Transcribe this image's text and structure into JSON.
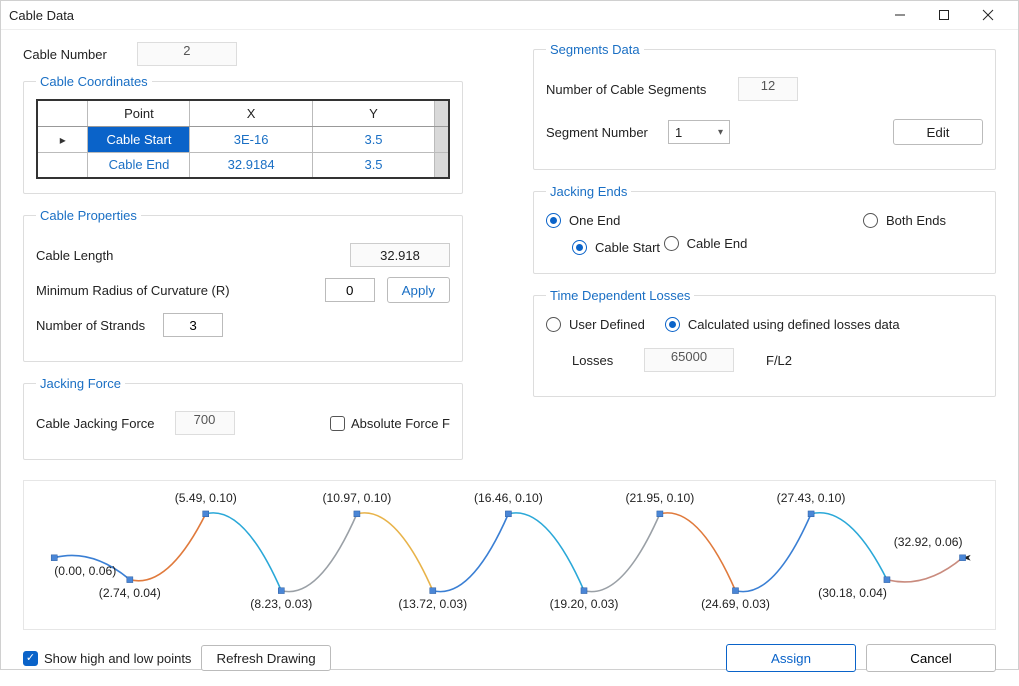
{
  "window": {
    "title": "Cable Data"
  },
  "cable_number": {
    "label": "Cable Number",
    "value": "2"
  },
  "coords": {
    "legend": "Cable Coordinates",
    "headers": {
      "point": "Point",
      "x": "X",
      "y": "Y"
    },
    "rows": [
      {
        "point": "Cable Start",
        "x": "3E-16",
        "y": "3.5",
        "selected": true
      },
      {
        "point": "Cable End",
        "x": "32.9184",
        "y": "3.5",
        "selected": false
      }
    ]
  },
  "properties": {
    "legend": "Cable Properties",
    "length_label": "Cable Length",
    "length_value": "32.918",
    "radius_label": "Minimum Radius of Curvature (R)",
    "radius_value": "0",
    "apply_label": "Apply",
    "strands_label": "Number of Strands",
    "strands_value": "3"
  },
  "jacking_force": {
    "legend": "Jacking Force",
    "label": "Cable Jacking Force",
    "value": "700",
    "absolute_label": "Absolute Force  F",
    "absolute_checked": false
  },
  "segments": {
    "legend": "Segments Data",
    "count_label": "Number of Cable Segments",
    "count_value": "12",
    "number_label": "Segment Number",
    "number_value": "1",
    "edit_label": "Edit"
  },
  "jacking_ends": {
    "legend": "Jacking Ends",
    "one_end": "One End",
    "both_ends": "Both Ends",
    "cable_start": "Cable Start",
    "cable_end": "Cable End",
    "selected_primary": "one_end",
    "selected_sub": "cable_start"
  },
  "losses": {
    "legend": "Time Dependent Losses",
    "user_defined": "User Defined",
    "calculated": "Calculated using defined losses data",
    "selected": "calculated",
    "losses_label": "Losses",
    "losses_value": "65000",
    "unit": "F/L2"
  },
  "graph": {
    "points": [
      {
        "x": 0.0,
        "y": 0.06,
        "pos": "below"
      },
      {
        "x": 2.74,
        "y": 0.04,
        "pos": "below"
      },
      {
        "x": 5.49,
        "y": 0.1,
        "pos": "above"
      },
      {
        "x": 8.23,
        "y": 0.03,
        "pos": "below"
      },
      {
        "x": 10.97,
        "y": 0.1,
        "pos": "above"
      },
      {
        "x": 13.72,
        "y": 0.03,
        "pos": "below"
      },
      {
        "x": 16.46,
        "y": 0.1,
        "pos": "above"
      },
      {
        "x": 19.2,
        "y": 0.03,
        "pos": "below"
      },
      {
        "x": 21.95,
        "y": 0.1,
        "pos": "above"
      },
      {
        "x": 24.69,
        "y": 0.03,
        "pos": "below"
      },
      {
        "x": 27.43,
        "y": 0.1,
        "pos": "above"
      },
      {
        "x": 30.18,
        "y": 0.04,
        "pos": "below"
      },
      {
        "x": 32.92,
        "y": 0.06,
        "pos": "above"
      }
    ],
    "segment_colors": [
      "#3a7fd4",
      "#e07a3c",
      "#2aa8d8",
      "#9aa0a6",
      "#e8b34a",
      "#3a7fd4",
      "#2aa8d8",
      "#9aa0a6",
      "#e07a3c",
      "#3a7fd4",
      "#2aa8d8",
      "#c98b7e"
    ]
  },
  "footer": {
    "show_points_label": "Show high and low points",
    "show_points_checked": true,
    "refresh_label": "Refresh Drawing",
    "assign_label": "Assign",
    "cancel_label": "Cancel"
  },
  "chart_data": {
    "type": "line",
    "title": "",
    "xlabel": "",
    "ylabel": "",
    "x": [
      0.0,
      2.74,
      5.49,
      8.23,
      10.97,
      13.72,
      16.46,
      19.2,
      21.95,
      24.69,
      27.43,
      30.18,
      32.92
    ],
    "y": [
      0.06,
      0.04,
      0.1,
      0.03,
      0.1,
      0.03,
      0.1,
      0.03,
      0.1,
      0.03,
      0.1,
      0.04,
      0.06
    ],
    "xlim": [
      0,
      33
    ],
    "ylim": [
      0.03,
      0.1
    ]
  }
}
